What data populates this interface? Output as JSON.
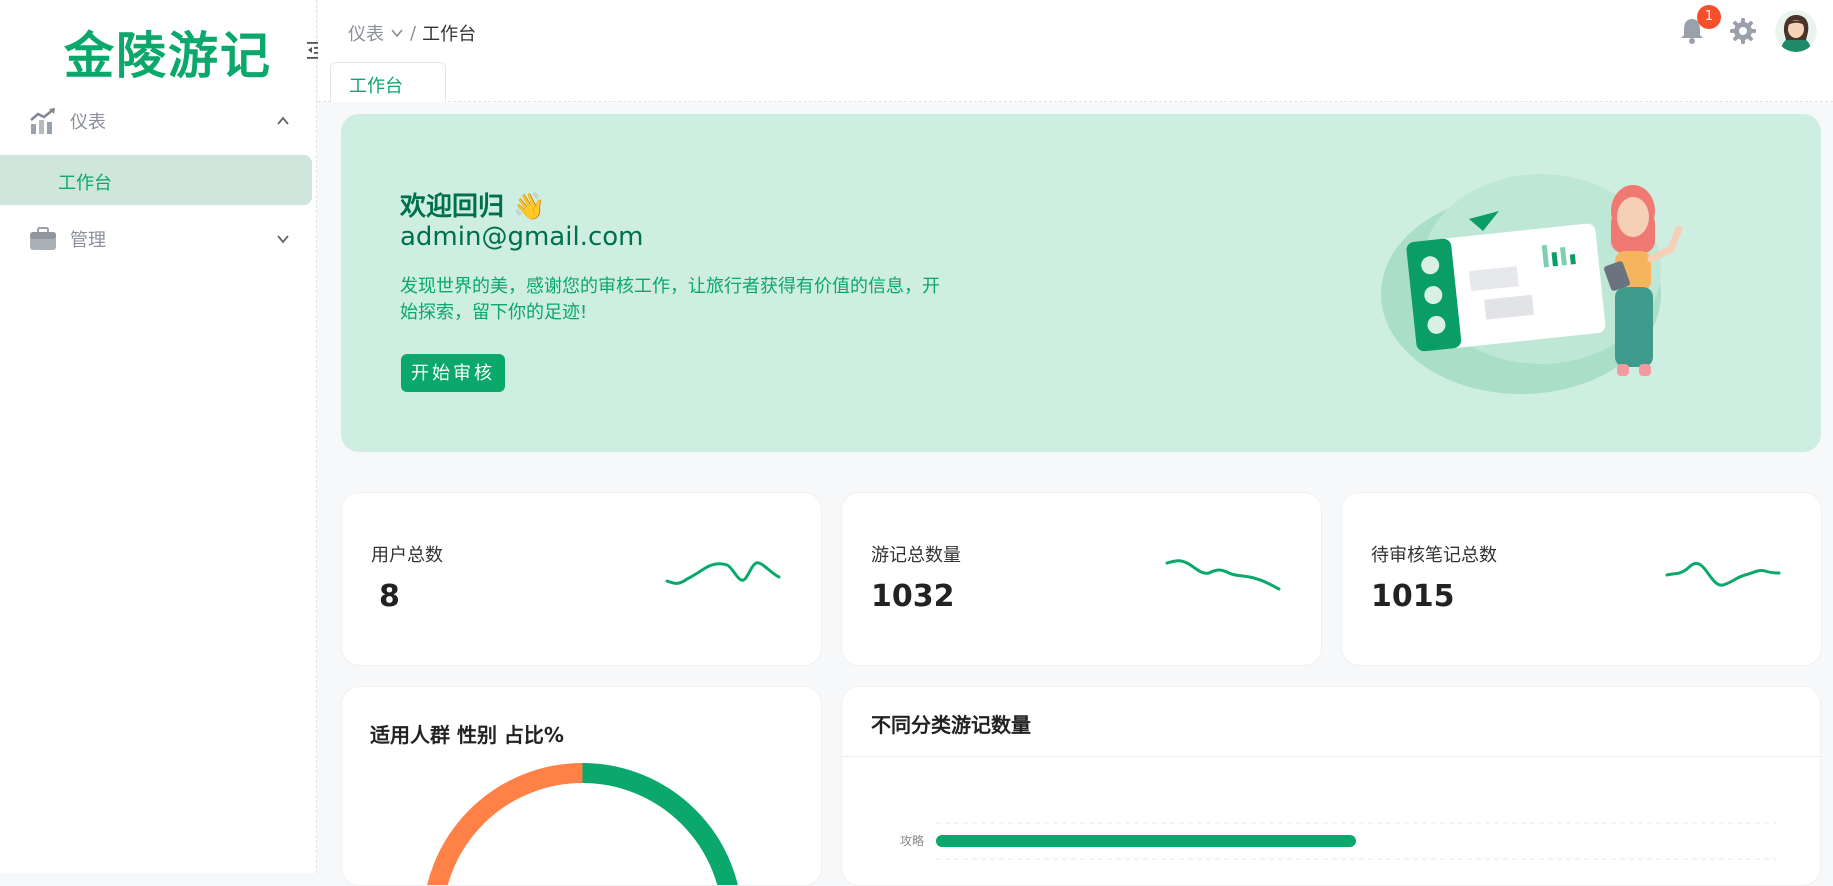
{
  "app": {
    "logo": "金陵游记"
  },
  "sidebar": {
    "items": [
      {
        "label": "仪表",
        "icon": "chart-up-icon",
        "expanded": true
      },
      {
        "label": "工作台",
        "active": true
      },
      {
        "label": "管理",
        "icon": "briefcase-icon",
        "expanded": false
      }
    ]
  },
  "header": {
    "breadcrumb": {
      "parent": "仪表",
      "separator": "/",
      "current": "工作台"
    },
    "tab": "工作台",
    "notifications_count": "1"
  },
  "hero": {
    "welcome": "欢迎回归 👋",
    "email": "admin@gmail.com",
    "description": "发现世界的美，感谢您的审核工作，让旅行者获得有价值的信息，开始探索，留下你的足迹!",
    "button": "开始审核"
  },
  "stats": [
    {
      "label": "用户总数",
      "value": "8"
    },
    {
      "label": "游记总数量",
      "value": "1032"
    },
    {
      "label": "待审核笔记总数",
      "value": "1015"
    }
  ],
  "gender_card": {
    "title": "适用人群 性别 占比%"
  },
  "category_card": {
    "title": "不同分类游记数量"
  },
  "chart_data": [
    {
      "type": "pie",
      "title": "适用人群 性别 占比%",
      "values": [
        50,
        50
      ],
      "colors": [
        "#0aa86b",
        "#ff8147"
      ]
    },
    {
      "type": "bar",
      "orientation": "horizontal",
      "title": "不同分类游记数量",
      "categories": [
        "攻略"
      ],
      "values": [
        0.5
      ],
      "color": "#0aa86b"
    }
  ],
  "colors": {
    "accent": "#0aa86b",
    "hero_bg": "#cdeee1",
    "badge": "#f5502b"
  }
}
